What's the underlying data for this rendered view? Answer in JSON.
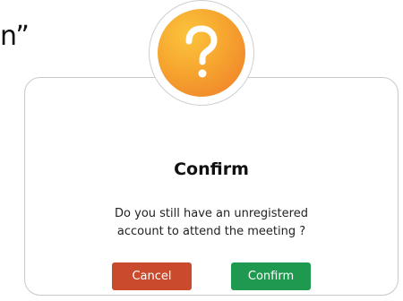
{
  "background": {
    "fragment_text": "n”"
  },
  "dialog": {
    "icon": "question-mark-icon",
    "icon_glyph": "?",
    "title": "Confirm",
    "message_line1": "Do you still have an unregistered",
    "message_line2": "account to attend the meeting ?",
    "cancel_label": "Cancel",
    "confirm_label": "Confirm"
  },
  "colors": {
    "icon_gradient_start": "#fcc43c",
    "icon_gradient_end": "#ee7a2a",
    "cancel_button": "#c94a2c",
    "confirm_button": "#1f9950"
  }
}
